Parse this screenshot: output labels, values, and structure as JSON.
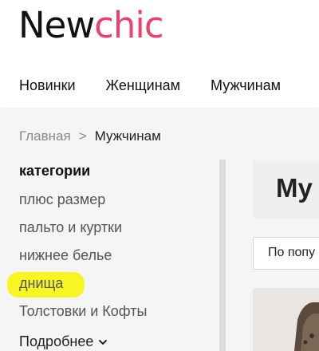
{
  "logo": {
    "part1": "New",
    "part2": "chic",
    "accent_color": "#e8436d"
  },
  "nav": {
    "items": [
      "Новинки",
      "Женщинам",
      "Мужчинам"
    ]
  },
  "breadcrumb": {
    "home": "Главная",
    "separator": ">",
    "current": "Мужчинам"
  },
  "sidebar": {
    "title": "категории",
    "items": [
      "плюс размер",
      "пальто и куртки",
      "нижнее белье",
      "днища",
      "Толстовки и Кофты"
    ],
    "more_label": "Подробнее",
    "highlight_color": "#f8f500"
  },
  "main": {
    "title": "Му",
    "sort_label": "По попу"
  }
}
